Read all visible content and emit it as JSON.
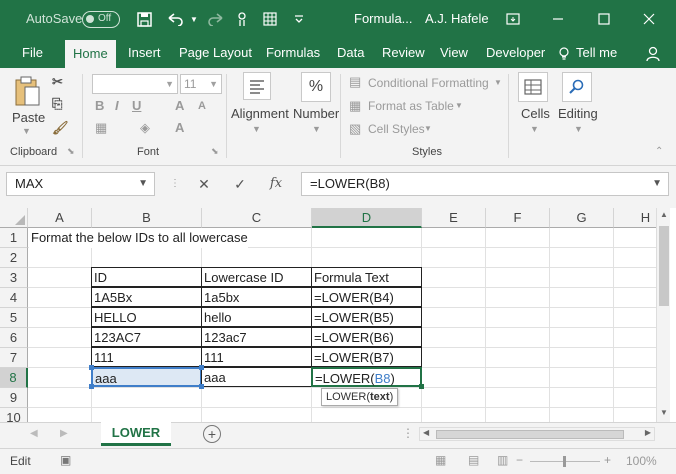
{
  "titlebar": {
    "autosave_label": "AutoSave",
    "autosave_state": "Off",
    "filename": "Formula...",
    "username": "A.J. Hafele"
  },
  "tabs": [
    "File",
    "Home",
    "Insert",
    "Page Layout",
    "Formulas",
    "Data",
    "Review",
    "View",
    "Developer",
    "Tell me"
  ],
  "active_tab": "Home",
  "ribbon": {
    "paste": "Paste",
    "font_size": "11",
    "alignment": "Alignment",
    "number": "Number",
    "conditional_formatting": "Conditional Formatting",
    "format_as_table": "Format as Table",
    "cell_styles": "Cell Styles",
    "cells": "Cells",
    "editing": "Editing",
    "groups": {
      "clipboard": "Clipboard",
      "font": "Font",
      "styles": "Styles"
    }
  },
  "formula_bar": {
    "name_box": "MAX",
    "fx": "fx",
    "formula": "=LOWER(B8)"
  },
  "grid": {
    "columns": [
      "A",
      "B",
      "C",
      "D",
      "E",
      "F",
      "G",
      "H"
    ],
    "selected_column": "D",
    "rows": [
      "1",
      "2",
      "3",
      "4",
      "5",
      "6",
      "7",
      "8",
      "9",
      "10"
    ],
    "selected_row": "8",
    "a1_text": "Format the below IDs to all lowercase",
    "table_header": [
      "ID",
      "Lowercase ID",
      "Formula Text"
    ],
    "table_rows": [
      [
        "1A5Bx",
        "1a5bx",
        "=LOWER(B4)"
      ],
      [
        "HELLO",
        "hello",
        "=LOWER(B5)"
      ],
      [
        "123AC7",
        "123ac7",
        "=LOWER(B6)"
      ],
      [
        "111",
        "111",
        "=LOWER(B7)"
      ],
      [
        "aaa",
        "aaa",
        "=LOWER(B8)"
      ]
    ],
    "edit_formula_prefix": "=LOWER(",
    "edit_formula_ref": "B8",
    "edit_formula_suffix": ")",
    "tooltip_func": "LOWER(",
    "tooltip_arg": "text",
    "tooltip_close": ")"
  },
  "sheets": {
    "active": "LOWER"
  },
  "status": {
    "mode": "Edit",
    "zoom": "100%"
  },
  "colors": {
    "accent": "#217346",
    "ref_blue": "#3f7ec9"
  }
}
